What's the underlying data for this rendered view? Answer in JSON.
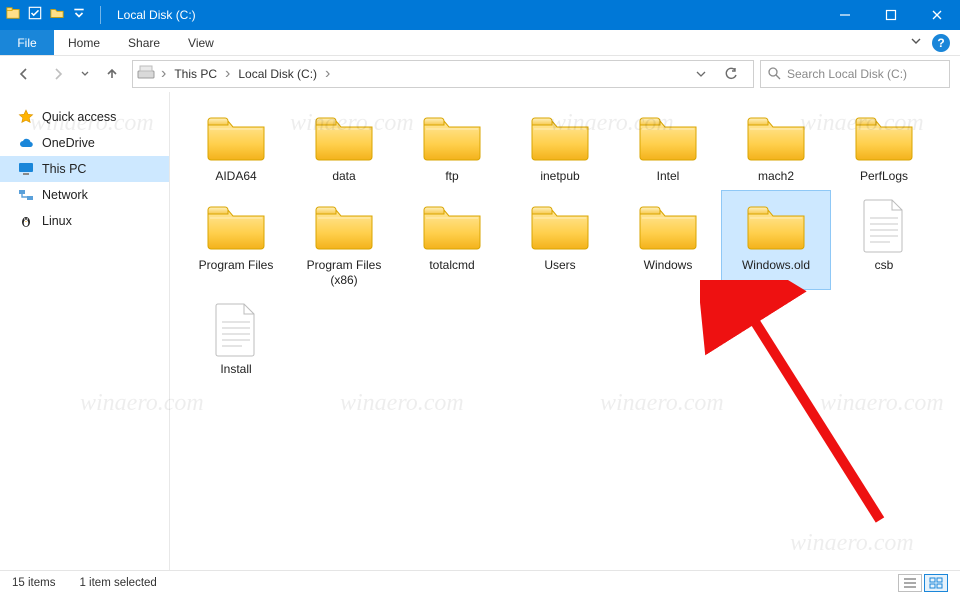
{
  "title": "Local Disk (C:)",
  "qat_dropdown_icon": "chevron-down",
  "tabs": {
    "file": "File",
    "home": "Home",
    "share": "Share",
    "view": "View"
  },
  "breadcrumbs": [
    "This PC",
    "Local Disk (C:)"
  ],
  "search_placeholder": "Search Local Disk (C:)",
  "sidebar": {
    "items": [
      {
        "label": "Quick access",
        "icon": "star",
        "selected": false
      },
      {
        "label": "OneDrive",
        "icon": "cloud",
        "selected": false
      },
      {
        "label": "This PC",
        "icon": "monitor",
        "selected": true
      },
      {
        "label": "Network",
        "icon": "network",
        "selected": false
      },
      {
        "label": "Linux",
        "icon": "penguin",
        "selected": false
      }
    ]
  },
  "items": [
    {
      "name": "AIDA64",
      "type": "folder",
      "selected": false
    },
    {
      "name": "data",
      "type": "folder",
      "selected": false
    },
    {
      "name": "ftp",
      "type": "folder",
      "selected": false
    },
    {
      "name": "inetpub",
      "type": "folder",
      "selected": false
    },
    {
      "name": "Intel",
      "type": "folder",
      "selected": false
    },
    {
      "name": "mach2",
      "type": "folder",
      "selected": false
    },
    {
      "name": "PerfLogs",
      "type": "folder",
      "selected": false
    },
    {
      "name": "Program Files",
      "type": "folder",
      "selected": false
    },
    {
      "name": "Program Files (x86)",
      "type": "folder",
      "selected": false
    },
    {
      "name": "totalcmd",
      "type": "folder",
      "selected": false
    },
    {
      "name": "Users",
      "type": "folder",
      "selected": false
    },
    {
      "name": "Windows",
      "type": "folder",
      "selected": false
    },
    {
      "name": "Windows.old",
      "type": "folder",
      "selected": true
    },
    {
      "name": "csb",
      "type": "file",
      "selected": false
    },
    {
      "name": "Install",
      "type": "file",
      "selected": false
    }
  ],
  "status": {
    "count_text": "15 items",
    "selection_text": "1 item selected"
  },
  "watermark_text": "winaero.com",
  "colors": {
    "accent": "#0078d7",
    "selection": "#cde8ff"
  }
}
